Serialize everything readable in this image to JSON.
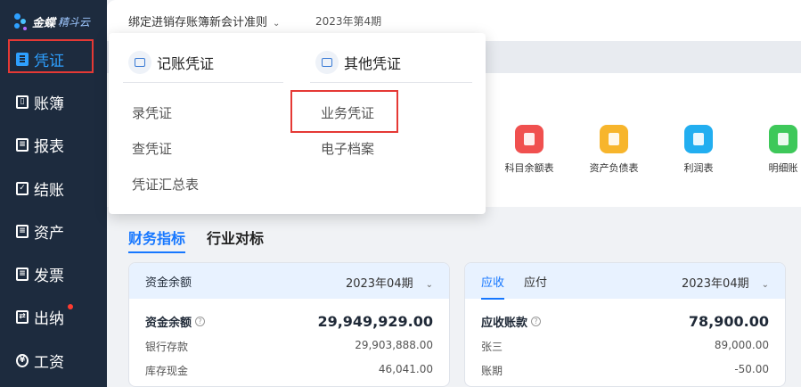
{
  "sidebar": {
    "logo_text": "金蝶",
    "logo_sub": "精斗云",
    "items": [
      {
        "label": "凭证",
        "icon": "voucher-icon",
        "glyph": ""
      },
      {
        "label": "账簿",
        "icon": "ledger-book-icon",
        "glyph": "▯"
      },
      {
        "label": "报表",
        "icon": "report-icon",
        "glyph": "≡"
      },
      {
        "label": "结账",
        "icon": "checkout-icon",
        "glyph": "✓"
      },
      {
        "label": "资产",
        "icon": "asset-icon",
        "glyph": "≡"
      },
      {
        "label": "发票",
        "icon": "invoice-icon",
        "glyph": "≡"
      },
      {
        "label": "出纳",
        "icon": "cashier-icon",
        "glyph": "⇄"
      },
      {
        "label": "工资",
        "icon": "salary-icon",
        "glyph": "¥"
      }
    ]
  },
  "topbar": {
    "ledger_name": "绑定进销存账簿新会计准则",
    "period": "2023年第4期"
  },
  "popup": {
    "left_title": "记账凭证",
    "right_title": "其他凭证",
    "left_items": [
      "录凭证",
      "查凭证",
      "凭证汇总表"
    ],
    "right_items": [
      "业务凭证",
      "电子档案"
    ]
  },
  "quick_links": [
    {
      "label": "科目余额表",
      "color": "#f0504f"
    },
    {
      "label": "资产负债表",
      "color": "#f7b52c"
    },
    {
      "label": "利润表",
      "color": "#22aef0"
    },
    {
      "label": "明细账",
      "color": "#3ec85a"
    }
  ],
  "tabs": {
    "finance": "财务指标",
    "industry": "行业对标"
  },
  "fund_panel": {
    "title": "资金余额",
    "period": "2023年04期",
    "main_label": "资金余额",
    "main_value": "29,949,929.00",
    "rows": [
      {
        "label": "银行存款",
        "value": "29,903,888.00"
      },
      {
        "label": "库存现金",
        "value": "46,041.00"
      }
    ]
  },
  "ar_panel": {
    "tab_receivable": "应收",
    "tab_payable": "应付",
    "period": "2023年04期",
    "main_label": "应收账款",
    "main_value": "78,900.00",
    "rows": [
      {
        "label": "张三",
        "value": "89,000.00"
      },
      {
        "label": "账期",
        "value": "-50.00"
      }
    ]
  }
}
